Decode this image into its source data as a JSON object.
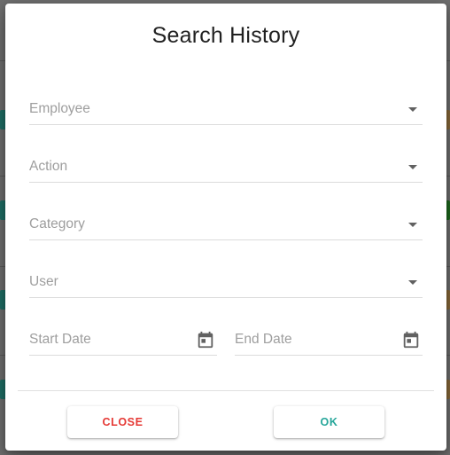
{
  "dialog": {
    "title": "Search History",
    "fields": {
      "employee": {
        "label": "Employee"
      },
      "action": {
        "label": "Action"
      },
      "category": {
        "label": "Category"
      },
      "user": {
        "label": "User"
      },
      "start_date": {
        "label": "Start Date"
      },
      "end_date": {
        "label": "End Date"
      }
    },
    "buttons": {
      "close": {
        "label": "CLOSE",
        "color": "#e53935"
      },
      "ok": {
        "label": "OK",
        "color": "#26a69a"
      }
    }
  },
  "icons": {
    "dropdown": "chevron-down-icon",
    "date_picker": "calendar-icon"
  },
  "colors": {
    "backdrop": "#6f6f6f",
    "label": "#9e9e9e",
    "title": "#212121"
  }
}
